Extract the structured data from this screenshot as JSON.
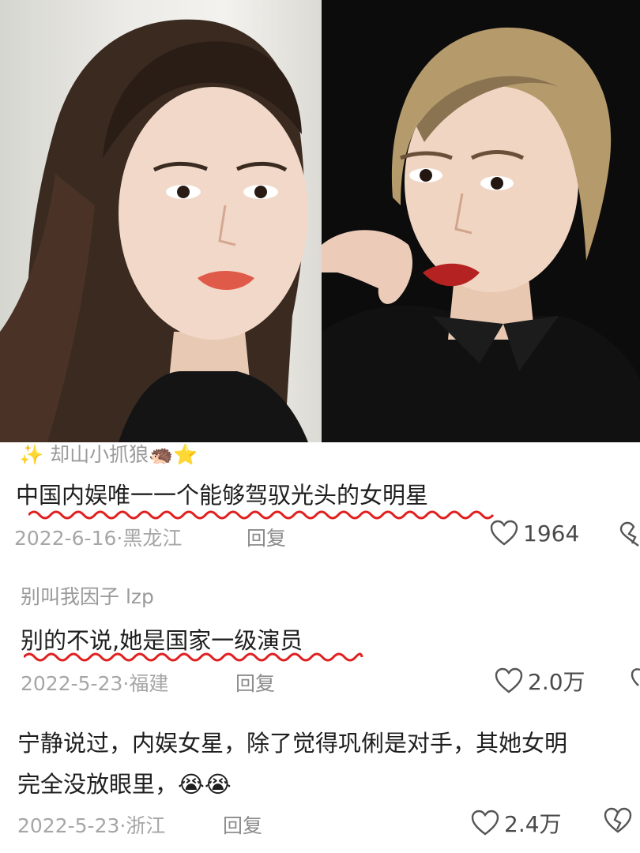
{
  "photos": {
    "left": {
      "subject": "young-woman-dark-hair-portrait"
    },
    "right": {
      "subject": "woman-short-blonde-hair-red-lips-portrait"
    }
  },
  "comments": [
    {
      "username": "✨ 却山小抓狼🦔⭐",
      "text": "中国内娱唯一一个能够驾驭光头的女明星",
      "date": "2022-6-16",
      "location": "黑龙江",
      "reply": "回复",
      "likes": "1964"
    },
    {
      "username": "别叫我因子 lzp",
      "text": "别的不说,她是国家一级演员",
      "date": "2022-5-23",
      "location": "福建",
      "reply": "回复",
      "likes": "2.0万"
    },
    {
      "username": "",
      "text_line1": "宁静说过，内娱女星，除了觉得巩俐是对手，其她女明",
      "text_line2": "完全没放眼里，😭😭",
      "date": "2022-5-23",
      "location": "浙江",
      "reply": "回复",
      "likes": "2.4万"
    }
  ],
  "colors": {
    "underline": "#e02020",
    "meta_gray": "#a6a6a6",
    "text": "#1f1f1f"
  },
  "icons": [
    "heart-icon",
    "broken-heart-icon"
  ]
}
